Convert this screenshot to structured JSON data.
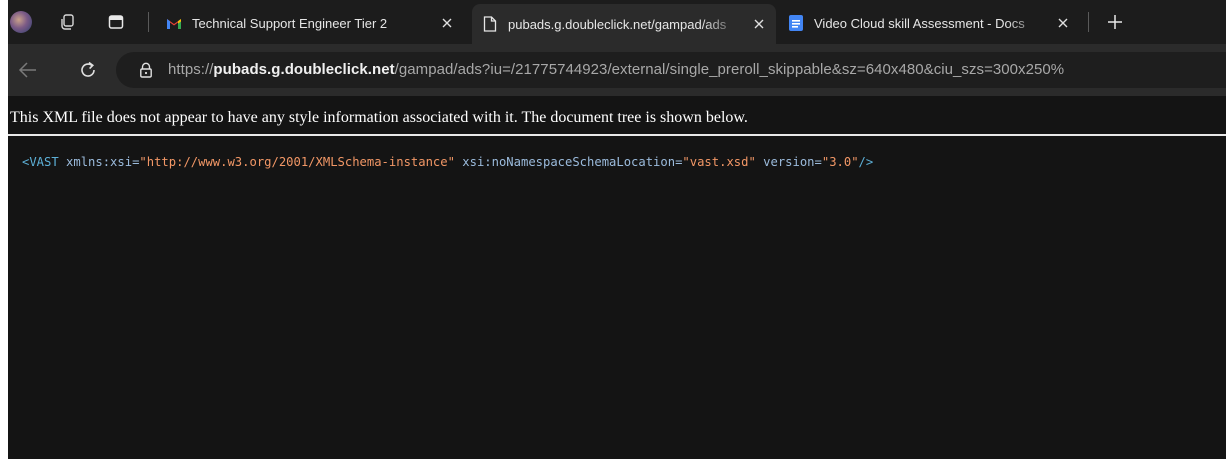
{
  "browser": {
    "tabs": [
      {
        "label": "Technical Support Engineer Tier 2",
        "icon": "gmail-icon",
        "active": false
      },
      {
        "label": "pubads.g.doubleclick.net/gampad/ads",
        "icon": "page-icon",
        "active": true
      },
      {
        "label": "Video Cloud skill Assessment - Docs",
        "icon": "docs-icon",
        "active": false
      }
    ],
    "new_tab_icon": "plus-icon",
    "address_bar": {
      "scheme": "https://",
      "host": "pubads.g.doubleclick.net",
      "path": "/gampad/ads?iu=/21775744923/external/single_preroll_skippable&sz=640x480&ciu_szs=300x250%"
    },
    "icons": {
      "profile": "profile-avatar-icon",
      "workspaces": "workspaces-icon",
      "tab_actions": "tab-actions-icon",
      "back": "back-arrow-icon",
      "reload": "reload-icon",
      "site_info": "lock-icon"
    }
  },
  "page": {
    "notice": "This XML file does not appear to have any style information associated with it. The document tree is shown below.",
    "xml": {
      "open": "<VAST",
      "attr1_name": "xmlns:xsi",
      "attr1_value": "\"http://www.w3.org/2001/XMLSchema-instance\"",
      "attr2_name": "xsi:noNamespaceSchemaLocation",
      "attr2_value": "\"vast.xsd\"",
      "attr3_name": "version",
      "attr3_value": "\"3.0\"",
      "close": "/>"
    }
  },
  "colors": {
    "tab_strip": "#1c1c1c",
    "toolbar": "#2b2b2b",
    "page_background": "#141414",
    "xml_tag": "#5db0d7",
    "xml_attribute": "#9bbbdc",
    "xml_value": "#f29766",
    "gmail_red": "#ea4335",
    "docs_blue": "#4285f4"
  }
}
